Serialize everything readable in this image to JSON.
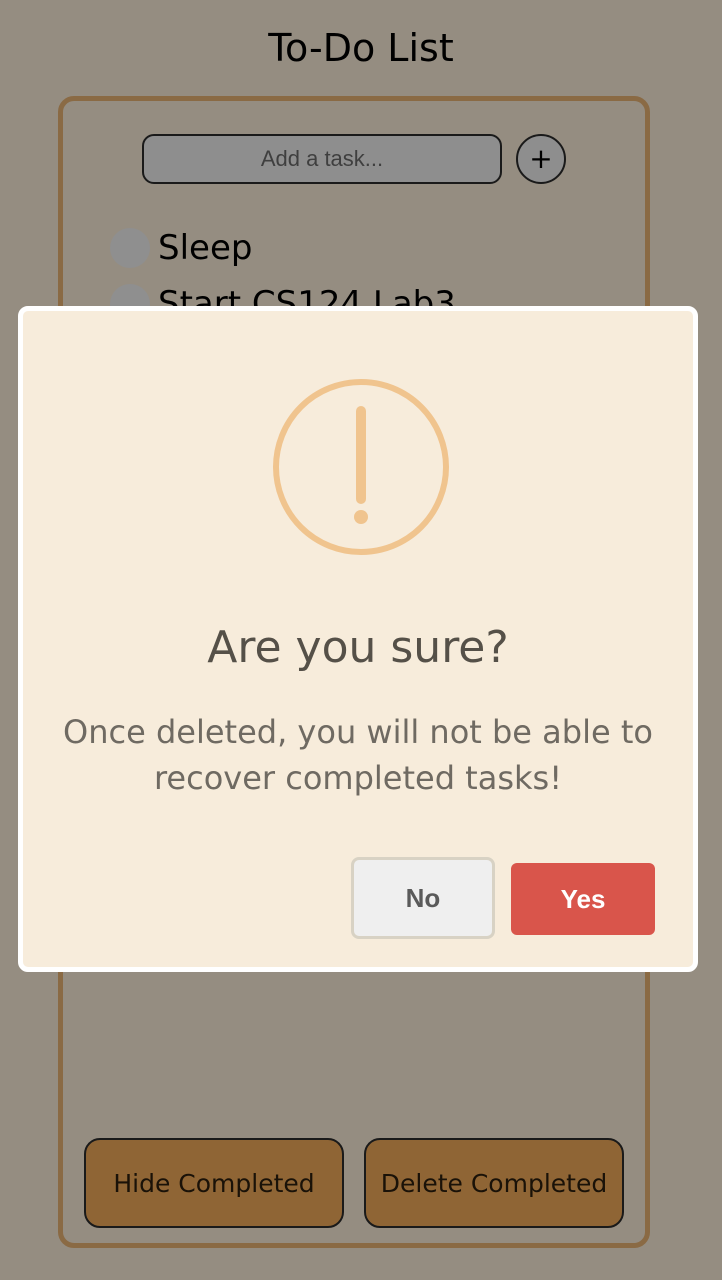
{
  "app": {
    "title": "To-Do List"
  },
  "task_input": {
    "placeholder": "Add a task...",
    "value": ""
  },
  "add_button": {
    "label": "+"
  },
  "tasks": [
    {
      "label": "Sleep"
    },
    {
      "label": "Start CS124 Lab3"
    }
  ],
  "footer": {
    "hide_completed_label": "Hide Completed",
    "delete_completed_label": "Delete Completed"
  },
  "dialog": {
    "icon": "warning-icon",
    "title": "Are you sure?",
    "text": "Once deleted, you will not be able to recover completed tasks!",
    "no_label": "No",
    "yes_label": "Yes"
  },
  "colors": {
    "background": "#958d81",
    "frame": "#8a6a44",
    "button": "#8f6535",
    "dialog": "#f7ecdb",
    "warning": "#f0c48e",
    "confirm": "#d9554b"
  }
}
